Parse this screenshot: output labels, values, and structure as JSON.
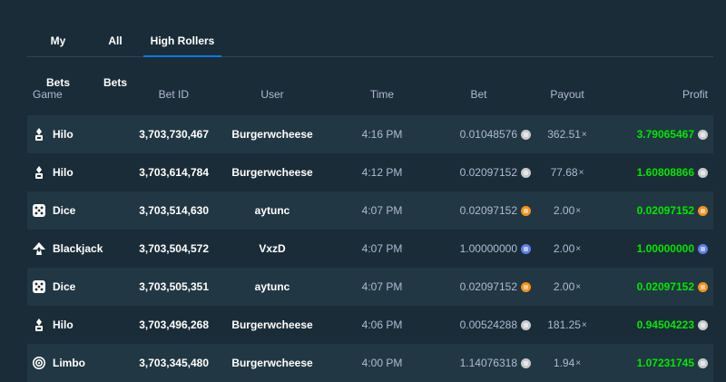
{
  "tabs": [
    {
      "label": "My Bets"
    },
    {
      "label": "All Bets"
    },
    {
      "label": "High Rollers",
      "active": true
    }
  ],
  "columns": {
    "game": "Game",
    "bet_id": "Bet ID",
    "user": "User",
    "time": "Time",
    "bet": "Bet",
    "payout": "Payout",
    "profit": "Profit"
  },
  "colors": {
    "background": "#1a2c38",
    "row_alt": "#213743",
    "accent": "#1475e1",
    "profit_green": "#00e701",
    "muted_text": "#b1bad3"
  },
  "rows": [
    {
      "game": "Hilo",
      "icon": "hilo-icon",
      "bet_id": "3,703,730,467",
      "user": "Burgerwcheese",
      "time": "4:16 PM",
      "bet": "0.01048576",
      "currency": "ltc",
      "payout": "362.51",
      "profit": "3.79065467"
    },
    {
      "game": "Hilo",
      "icon": "hilo-icon",
      "bet_id": "3,703,614,784",
      "user": "Burgerwcheese",
      "time": "4:12 PM",
      "bet": "0.02097152",
      "currency": "ltc",
      "payout": "77.68",
      "profit": "1.60808866"
    },
    {
      "game": "Dice",
      "icon": "dice-icon",
      "bet_id": "3,703,514,630",
      "user": "aytunc",
      "time": "4:07 PM",
      "bet": "0.02097152",
      "currency": "btc",
      "payout": "2.00",
      "profit": "0.02097152"
    },
    {
      "game": "Blackjack",
      "icon": "blackjack-icon",
      "bet_id": "3,703,504,572",
      "user": "VxzD",
      "time": "4:07 PM",
      "bet": "1.00000000",
      "currency": "eth",
      "payout": "2.00",
      "profit": "1.00000000"
    },
    {
      "game": "Dice",
      "icon": "dice-icon",
      "bet_id": "3,703,505,351",
      "user": "aytunc",
      "time": "4:07 PM",
      "bet": "0.02097152",
      "currency": "btc",
      "payout": "2.00",
      "profit": "0.02097152"
    },
    {
      "game": "Hilo",
      "icon": "hilo-icon",
      "bet_id": "3,703,496,268",
      "user": "Burgerwcheese",
      "time": "4:06 PM",
      "bet": "0.00524288",
      "currency": "ltc",
      "payout": "181.25",
      "profit": "0.94504223"
    },
    {
      "game": "Limbo",
      "icon": "limbo-icon",
      "bet_id": "3,703,345,480",
      "user": "Burgerwcheese",
      "time": "4:00 PM",
      "bet": "1.14076318",
      "currency": "ltc",
      "payout": "1.94",
      "profit": "1.07231745"
    }
  ],
  "multiplier_suffix": "×"
}
